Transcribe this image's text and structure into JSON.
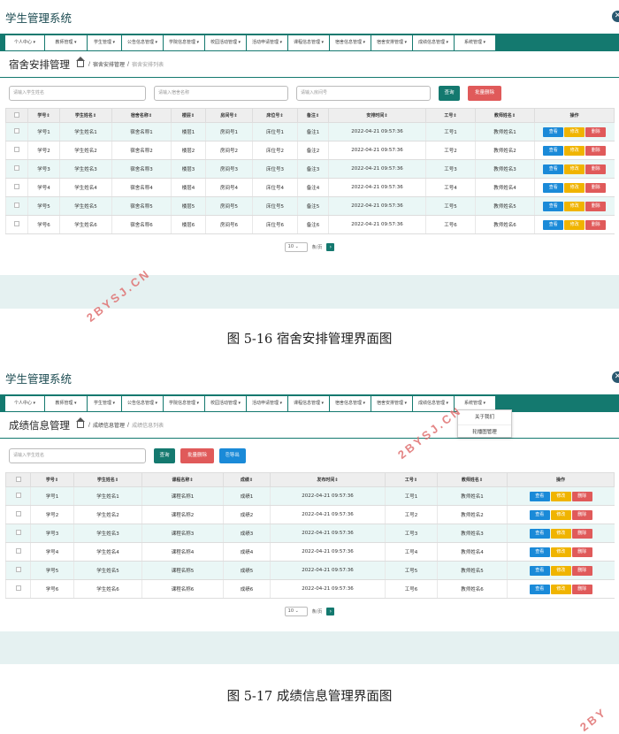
{
  "system_title": "学生管理系统",
  "nav1": [
    "个人中心",
    "教师管理",
    "学生管理",
    "公告信息管理",
    "学院信息管理",
    "校园活动管理",
    "活动申请管理",
    "课程信息管理",
    "宿舍信息管理",
    "宿舍安排管理",
    "成绩信息管理",
    "系统管理"
  ],
  "nav2": [
    "个人中心",
    "教师管理",
    "学生管理",
    "公告信息管理",
    "学院信息管理",
    "校园活动管理",
    "活动申请管理",
    "课程信息管理",
    "宿舍信息管理",
    "宿舍安排管理",
    "成绩信息管理",
    "系统管理"
  ],
  "page1": {
    "title": "宿舍安排管理",
    "breadcrumb": [
      "宿舍安排管理",
      "宿舍安排列表"
    ],
    "search_placeholders": [
      "请输入学生姓名",
      "请输入宿舍名称",
      "请输入房间号"
    ],
    "btn_query": "查询",
    "btn_batch_delete": "批量删除",
    "headers": [
      "学号",
      "学生姓名",
      "宿舍名称",
      "楼层",
      "房间号",
      "床位号",
      "备注",
      "安排时间",
      "工号",
      "教师姓名",
      "操作"
    ],
    "rows": [
      [
        "学号1",
        "学生姓名1",
        "宿舍名称1",
        "楼层1",
        "房间号1",
        "床位号1",
        "备注1",
        "2022-04-21 09:57:36",
        "工号1",
        "教师姓名1"
      ],
      [
        "学号2",
        "学生姓名2",
        "宿舍名称2",
        "楼层2",
        "房间号2",
        "床位号2",
        "备注2",
        "2022-04-21 09:57:36",
        "工号2",
        "教师姓名2"
      ],
      [
        "学号3",
        "学生姓名3",
        "宿舍名称3",
        "楼层3",
        "房间号3",
        "床位号3",
        "备注3",
        "2022-04-21 09:57:36",
        "工号3",
        "教师姓名3"
      ],
      [
        "学号4",
        "学生姓名4",
        "宿舍名称4",
        "楼层4",
        "房间号4",
        "床位号4",
        "备注4",
        "2022-04-21 09:57:36",
        "工号4",
        "教师姓名4"
      ],
      [
        "学号5",
        "学生姓名5",
        "宿舍名称5",
        "楼层5",
        "房间号5",
        "床位号5",
        "备注5",
        "2022-04-21 09:57:36",
        "工号5",
        "教师姓名5"
      ],
      [
        "学号6",
        "学生姓名6",
        "宿舍名称6",
        "楼层6",
        "房间号6",
        "床位号6",
        "备注6",
        "2022-04-21 09:57:36",
        "工号6",
        "教师姓名6"
      ]
    ],
    "ops": [
      "查看",
      "修改",
      "删除"
    ],
    "page_size": "10",
    "page_label": "条/页",
    "caption": "图 5-16 宿舍安排管理界面图"
  },
  "page2": {
    "title": "成绩信息管理",
    "breadcrumb": [
      "成绩信息管理",
      "成绩信息列表"
    ],
    "search_placeholder": "请输入学生姓名",
    "btn_query": "查询",
    "btn_batch_delete": "批量删除",
    "btn_export": "导出",
    "headers": [
      "学号",
      "学生姓名",
      "课程名称",
      "成绩",
      "发布时间",
      "工号",
      "教师姓名",
      "操作"
    ],
    "rows": [
      [
        "学号1",
        "学生姓名1",
        "课程名称1",
        "成绩1",
        "2022-04-21 09:57:36",
        "工号1",
        "教师姓名1"
      ],
      [
        "学号2",
        "学生姓名2",
        "课程名称2",
        "成绩2",
        "2022-04-21 09:57:36",
        "工号2",
        "教师姓名2"
      ],
      [
        "学号3",
        "学生姓名3",
        "课程名称3",
        "成绩3",
        "2022-04-21 09:57:36",
        "工号3",
        "教师姓名3"
      ],
      [
        "学号4",
        "学生姓名4",
        "课程名称4",
        "成绩4",
        "2022-04-21 09:57:36",
        "工号4",
        "教师姓名4"
      ],
      [
        "学号5",
        "学生姓名5",
        "课程名称5",
        "成绩5",
        "2022-04-21 09:57:36",
        "工号5",
        "教师姓名5"
      ],
      [
        "学号6",
        "学生姓名6",
        "课程名称6",
        "成绩6",
        "2022-04-21 09:57:36",
        "工号6",
        "教师姓名6"
      ]
    ],
    "ops": [
      "查看",
      "修改",
      "删除"
    ],
    "dropdown": [
      "关于我们",
      "轮播图管理"
    ],
    "page_size": "10",
    "page_label": "条/页",
    "caption": "图 5-17 成绩信息管理界面图"
  },
  "watermark": "2BYSJ.CN",
  "watermark_short": "2BY"
}
